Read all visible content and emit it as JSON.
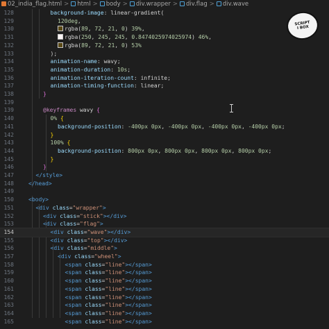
{
  "breadcrumb": {
    "items": [
      "02_india_flag.html",
      "html",
      "body",
      "div.wrapper",
      "div.flag",
      "div.wave"
    ],
    "separator": ">"
  },
  "badge": {
    "line1": "SCRIPT",
    "line2": "I BOX"
  },
  "lines": [
    {
      "n": "128",
      "indent": 1,
      "tokens": [
        {
          "c": "t-prop",
          "t": "background-image"
        },
        {
          "c": "t-op",
          "t": ": "
        },
        {
          "c": "t-val",
          "t": "linear-gradient("
        }
      ]
    },
    {
      "n": "129",
      "indent": 2,
      "tokens": [
        {
          "c": "t-num",
          "t": "120deg"
        },
        {
          "c": "t-op",
          "t": ","
        }
      ]
    },
    {
      "n": "130",
      "indent": 2,
      "swatch": "#594815",
      "tokens": [
        {
          "c": "t-val",
          "t": "rgba("
        },
        {
          "c": "t-num",
          "t": "89"
        },
        {
          "c": "t-op",
          "t": ", "
        },
        {
          "c": "t-num",
          "t": "72"
        },
        {
          "c": "t-op",
          "t": ", "
        },
        {
          "c": "t-num",
          "t": "21"
        },
        {
          "c": "t-op",
          "t": ", "
        },
        {
          "c": "t-num",
          "t": "0"
        },
        {
          "c": "t-val",
          "t": ") "
        },
        {
          "c": "t-num",
          "t": "39%"
        },
        {
          "c": "t-op",
          "t": ","
        }
      ]
    },
    {
      "n": "131",
      "indent": 2,
      "swatch": "#faf5f5",
      "tokens": [
        {
          "c": "t-val",
          "t": "rgba("
        },
        {
          "c": "t-num",
          "t": "250"
        },
        {
          "c": "t-op",
          "t": ", "
        },
        {
          "c": "t-num",
          "t": "245"
        },
        {
          "c": "t-op",
          "t": ", "
        },
        {
          "c": "t-num",
          "t": "245"
        },
        {
          "c": "t-op",
          "t": ", "
        },
        {
          "c": "t-num",
          "t": "0.8474025974025974"
        },
        {
          "c": "t-val",
          "t": ") "
        },
        {
          "c": "t-num",
          "t": "46%"
        },
        {
          "c": "t-op",
          "t": ","
        }
      ]
    },
    {
      "n": "132",
      "indent": 2,
      "swatch": "#594815",
      "tokens": [
        {
          "c": "t-val",
          "t": "rgba("
        },
        {
          "c": "t-num",
          "t": "89"
        },
        {
          "c": "t-op",
          "t": ", "
        },
        {
          "c": "t-num",
          "t": "72"
        },
        {
          "c": "t-op",
          "t": ", "
        },
        {
          "c": "t-num",
          "t": "21"
        },
        {
          "c": "t-op",
          "t": ", "
        },
        {
          "c": "t-num",
          "t": "0"
        },
        {
          "c": "t-val",
          "t": ") "
        },
        {
          "c": "t-num",
          "t": "53%"
        }
      ]
    },
    {
      "n": "133",
      "indent": 1,
      "tokens": [
        {
          "c": "t-val",
          "t": ");"
        }
      ]
    },
    {
      "n": "134",
      "indent": 1,
      "tokens": [
        {
          "c": "t-prop",
          "t": "animation-name"
        },
        {
          "c": "t-op",
          "t": ": "
        },
        {
          "c": "t-val",
          "t": "wavy;"
        }
      ]
    },
    {
      "n": "135",
      "indent": 1,
      "tokens": [
        {
          "c": "t-prop",
          "t": "animation-duration"
        },
        {
          "c": "t-op",
          "t": ": "
        },
        {
          "c": "t-num",
          "t": "10s"
        },
        {
          "c": "t-op",
          "t": ";"
        }
      ]
    },
    {
      "n": "136",
      "indent": 1,
      "tokens": [
        {
          "c": "t-prop",
          "t": "animation-iteration-count"
        },
        {
          "c": "t-op",
          "t": ": "
        },
        {
          "c": "t-val",
          "t": "infinite;"
        }
      ]
    },
    {
      "n": "137",
      "indent": 1,
      "tokens": [
        {
          "c": "t-prop",
          "t": "animation-timing-function"
        },
        {
          "c": "t-op",
          "t": ": "
        },
        {
          "c": "t-val",
          "t": "linear;"
        }
      ]
    },
    {
      "n": "138",
      "indent": 0,
      "tokens": [
        {
          "c": "t-brace2",
          "t": "}"
        }
      ]
    },
    {
      "n": "139",
      "indent": 0,
      "tokens": []
    },
    {
      "n": "139",
      "indent": 0,
      "tokens": [
        {
          "c": "t-key",
          "t": "@keyframes"
        },
        {
          "c": "t-val",
          "t": " wavy "
        },
        {
          "c": "t-brace2",
          "t": "{"
        }
      ]
    },
    {
      "n": "140",
      "indent": 1,
      "tokens": [
        {
          "c": "t-num",
          "t": "0%"
        },
        {
          "c": "t-val",
          "t": " "
        },
        {
          "c": "t-brace",
          "t": "{"
        }
      ]
    },
    {
      "n": "141",
      "indent": 2,
      "tokens": [
        {
          "c": "t-prop",
          "t": "background-position"
        },
        {
          "c": "t-op",
          "t": ": "
        },
        {
          "c": "t-num",
          "t": "-400px 0px"
        },
        {
          "c": "t-op",
          "t": ", "
        },
        {
          "c": "t-num",
          "t": "-400px 0px"
        },
        {
          "c": "t-op",
          "t": ", "
        },
        {
          "c": "t-num",
          "t": "-400px 0px"
        },
        {
          "c": "t-op",
          "t": ", "
        },
        {
          "c": "t-num",
          "t": "-400px 0px"
        },
        {
          "c": "t-op",
          "t": ";"
        }
      ]
    },
    {
      "n": "142",
      "indent": 1,
      "tokens": [
        {
          "c": "t-brace",
          "t": "}"
        }
      ]
    },
    {
      "n": "143",
      "indent": 1,
      "tokens": [
        {
          "c": "t-num",
          "t": "100%"
        },
        {
          "c": "t-val",
          "t": " "
        },
        {
          "c": "t-brace",
          "t": "{"
        }
      ]
    },
    {
      "n": "144",
      "indent": 2,
      "tokens": [
        {
          "c": "t-prop",
          "t": "background-position"
        },
        {
          "c": "t-op",
          "t": ": "
        },
        {
          "c": "t-num",
          "t": "800px 0px"
        },
        {
          "c": "t-op",
          "t": ", "
        },
        {
          "c": "t-num",
          "t": "800px 0px"
        },
        {
          "c": "t-op",
          "t": ", "
        },
        {
          "c": "t-num",
          "t": "800px 0px"
        },
        {
          "c": "t-op",
          "t": ", "
        },
        {
          "c": "t-num",
          "t": "800px 0px"
        },
        {
          "c": "t-op",
          "t": ";"
        }
      ]
    },
    {
      "n": "145",
      "indent": 1,
      "tokens": [
        {
          "c": "t-brace",
          "t": "}"
        }
      ]
    },
    {
      "n": "146",
      "indent": 0,
      "tokens": [
        {
          "c": "t-brace2",
          "t": "}"
        }
      ]
    },
    {
      "n": "147",
      "indent": -1,
      "tokens": [
        {
          "c": "t-tag",
          "t": "</"
        },
        {
          "c": "t-tag",
          "t": "style"
        },
        {
          "c": "t-tag",
          "t": ">"
        }
      ]
    },
    {
      "n": "148",
      "indent": -2,
      "tokens": [
        {
          "c": "t-tag",
          "t": "</"
        },
        {
          "c": "t-tag",
          "t": "head"
        },
        {
          "c": "t-tag",
          "t": ">"
        }
      ]
    },
    {
      "n": "149",
      "indent": -2,
      "tokens": []
    },
    {
      "n": "150",
      "indent": -2,
      "tokens": [
        {
          "c": "t-tag",
          "t": "<"
        },
        {
          "c": "t-tag",
          "t": "body"
        },
        {
          "c": "t-tag",
          "t": ">"
        }
      ]
    },
    {
      "n": "151",
      "indent": -1,
      "tokens": [
        {
          "c": "t-tag",
          "t": "<"
        },
        {
          "c": "t-tag",
          "t": "div"
        },
        {
          "c": "t-attr",
          "t": " class"
        },
        {
          "c": "t-op",
          "t": "="
        },
        {
          "c": "t-str",
          "t": "\"wrapper\""
        },
        {
          "c": "t-tag",
          "t": ">"
        }
      ]
    },
    {
      "n": "152",
      "indent": 0,
      "tokens": [
        {
          "c": "t-tag",
          "t": "<"
        },
        {
          "c": "t-tag",
          "t": "div"
        },
        {
          "c": "t-attr",
          "t": " class"
        },
        {
          "c": "t-op",
          "t": "="
        },
        {
          "c": "t-str",
          "t": "\"stick\""
        },
        {
          "c": "t-tag",
          "t": "></"
        },
        {
          "c": "t-tag",
          "t": "div"
        },
        {
          "c": "t-tag",
          "t": ">"
        }
      ]
    },
    {
      "n": "153",
      "indent": 0,
      "tokens": [
        {
          "c": "t-tag",
          "t": "<"
        },
        {
          "c": "t-tag",
          "t": "div"
        },
        {
          "c": "t-attr",
          "t": " class"
        },
        {
          "c": "t-op",
          "t": "="
        },
        {
          "c": "t-str",
          "t": "\"flag\""
        },
        {
          "c": "t-tag",
          "t": ">"
        }
      ]
    },
    {
      "n": "154",
      "indent": 1,
      "active": true,
      "tokens": [
        {
          "c": "t-tag",
          "t": "<"
        },
        {
          "c": "t-tag",
          "t": "div"
        },
        {
          "c": "t-attr",
          "t": " class"
        },
        {
          "c": "t-op",
          "t": "="
        },
        {
          "c": "t-str",
          "t": "\"wave\""
        },
        {
          "c": "t-tag",
          "t": "></"
        },
        {
          "c": "t-tag",
          "t": "div"
        },
        {
          "c": "t-tag",
          "t": ">"
        }
      ]
    },
    {
      "n": "155",
      "indent": 1,
      "tokens": [
        {
          "c": "t-tag",
          "t": "<"
        },
        {
          "c": "t-tag",
          "t": "div"
        },
        {
          "c": "t-attr",
          "t": " class"
        },
        {
          "c": "t-op",
          "t": "="
        },
        {
          "c": "t-str",
          "t": "\"top\""
        },
        {
          "c": "t-tag",
          "t": "></"
        },
        {
          "c": "t-tag",
          "t": "div"
        },
        {
          "c": "t-tag",
          "t": ">"
        }
      ]
    },
    {
      "n": "156",
      "indent": 1,
      "tokens": [
        {
          "c": "t-tag",
          "t": "<"
        },
        {
          "c": "t-tag",
          "t": "div"
        },
        {
          "c": "t-attr",
          "t": " class"
        },
        {
          "c": "t-op",
          "t": "="
        },
        {
          "c": "t-str",
          "t": "\"middle\""
        },
        {
          "c": "t-tag",
          "t": ">"
        }
      ]
    },
    {
      "n": "157",
      "indent": 2,
      "tokens": [
        {
          "c": "t-tag",
          "t": "<"
        },
        {
          "c": "t-tag",
          "t": "div"
        },
        {
          "c": "t-attr",
          "t": " class"
        },
        {
          "c": "t-op",
          "t": "="
        },
        {
          "c": "t-str",
          "t": "\"wheel\""
        },
        {
          "c": "t-tag",
          "t": ">"
        }
      ]
    },
    {
      "n": "158",
      "indent": 3,
      "tokens": [
        {
          "c": "t-tag",
          "t": "<"
        },
        {
          "c": "t-tag",
          "t": "span"
        },
        {
          "c": "t-attr",
          "t": " class"
        },
        {
          "c": "t-op",
          "t": "="
        },
        {
          "c": "t-str",
          "t": "\"line\""
        },
        {
          "c": "t-tag",
          "t": "></"
        },
        {
          "c": "t-tag",
          "t": "span"
        },
        {
          "c": "t-tag",
          "t": ">"
        }
      ]
    },
    {
      "n": "159",
      "indent": 3,
      "tokens": [
        {
          "c": "t-tag",
          "t": "<"
        },
        {
          "c": "t-tag",
          "t": "span"
        },
        {
          "c": "t-attr",
          "t": " class"
        },
        {
          "c": "t-op",
          "t": "="
        },
        {
          "c": "t-str",
          "t": "\"line\""
        },
        {
          "c": "t-tag",
          "t": "></"
        },
        {
          "c": "t-tag",
          "t": "span"
        },
        {
          "c": "t-tag",
          "t": ">"
        }
      ]
    },
    {
      "n": "160",
      "indent": 3,
      "tokens": [
        {
          "c": "t-tag",
          "t": "<"
        },
        {
          "c": "t-tag",
          "t": "span"
        },
        {
          "c": "t-attr",
          "t": " class"
        },
        {
          "c": "t-op",
          "t": "="
        },
        {
          "c": "t-str",
          "t": "\"line\""
        },
        {
          "c": "t-tag",
          "t": "></"
        },
        {
          "c": "t-tag",
          "t": "span"
        },
        {
          "c": "t-tag",
          "t": ">"
        }
      ]
    },
    {
      "n": "161",
      "indent": 3,
      "tokens": [
        {
          "c": "t-tag",
          "t": "<"
        },
        {
          "c": "t-tag",
          "t": "span"
        },
        {
          "c": "t-attr",
          "t": " class"
        },
        {
          "c": "t-op",
          "t": "="
        },
        {
          "c": "t-str",
          "t": "\"line\""
        },
        {
          "c": "t-tag",
          "t": "></"
        },
        {
          "c": "t-tag",
          "t": "span"
        },
        {
          "c": "t-tag",
          "t": ">"
        }
      ]
    },
    {
      "n": "162",
      "indent": 3,
      "tokens": [
        {
          "c": "t-tag",
          "t": "<"
        },
        {
          "c": "t-tag",
          "t": "span"
        },
        {
          "c": "t-attr",
          "t": " class"
        },
        {
          "c": "t-op",
          "t": "="
        },
        {
          "c": "t-str",
          "t": "\"line\""
        },
        {
          "c": "t-tag",
          "t": "></"
        },
        {
          "c": "t-tag",
          "t": "span"
        },
        {
          "c": "t-tag",
          "t": ">"
        }
      ]
    },
    {
      "n": "163",
      "indent": 3,
      "tokens": [
        {
          "c": "t-tag",
          "t": "<"
        },
        {
          "c": "t-tag",
          "t": "span"
        },
        {
          "c": "t-attr",
          "t": " class"
        },
        {
          "c": "t-op",
          "t": "="
        },
        {
          "c": "t-str",
          "t": "\"line\""
        },
        {
          "c": "t-tag",
          "t": "></"
        },
        {
          "c": "t-tag",
          "t": "span"
        },
        {
          "c": "t-tag",
          "t": ">"
        }
      ]
    },
    {
      "n": "164",
      "indent": 3,
      "tokens": [
        {
          "c": "t-tag",
          "t": "<"
        },
        {
          "c": "t-tag",
          "t": "span"
        },
        {
          "c": "t-attr",
          "t": " class"
        },
        {
          "c": "t-op",
          "t": "="
        },
        {
          "c": "t-str",
          "t": "\"line\""
        },
        {
          "c": "t-tag",
          "t": "></"
        },
        {
          "c": "t-tag",
          "t": "span"
        },
        {
          "c": "t-tag",
          "t": ">"
        }
      ]
    },
    {
      "n": "165",
      "indent": 3,
      "tokens": [
        {
          "c": "t-tag",
          "t": "<"
        },
        {
          "c": "t-tag",
          "t": "span"
        },
        {
          "c": "t-attr",
          "t": " class"
        },
        {
          "c": "t-op",
          "t": "="
        },
        {
          "c": "t-str",
          "t": "\"line\""
        },
        {
          "c": "t-tag",
          "t": "></"
        },
        {
          "c": "t-tag",
          "t": "span"
        },
        {
          "c": "t-tag",
          "t": ">"
        }
      ]
    }
  ]
}
